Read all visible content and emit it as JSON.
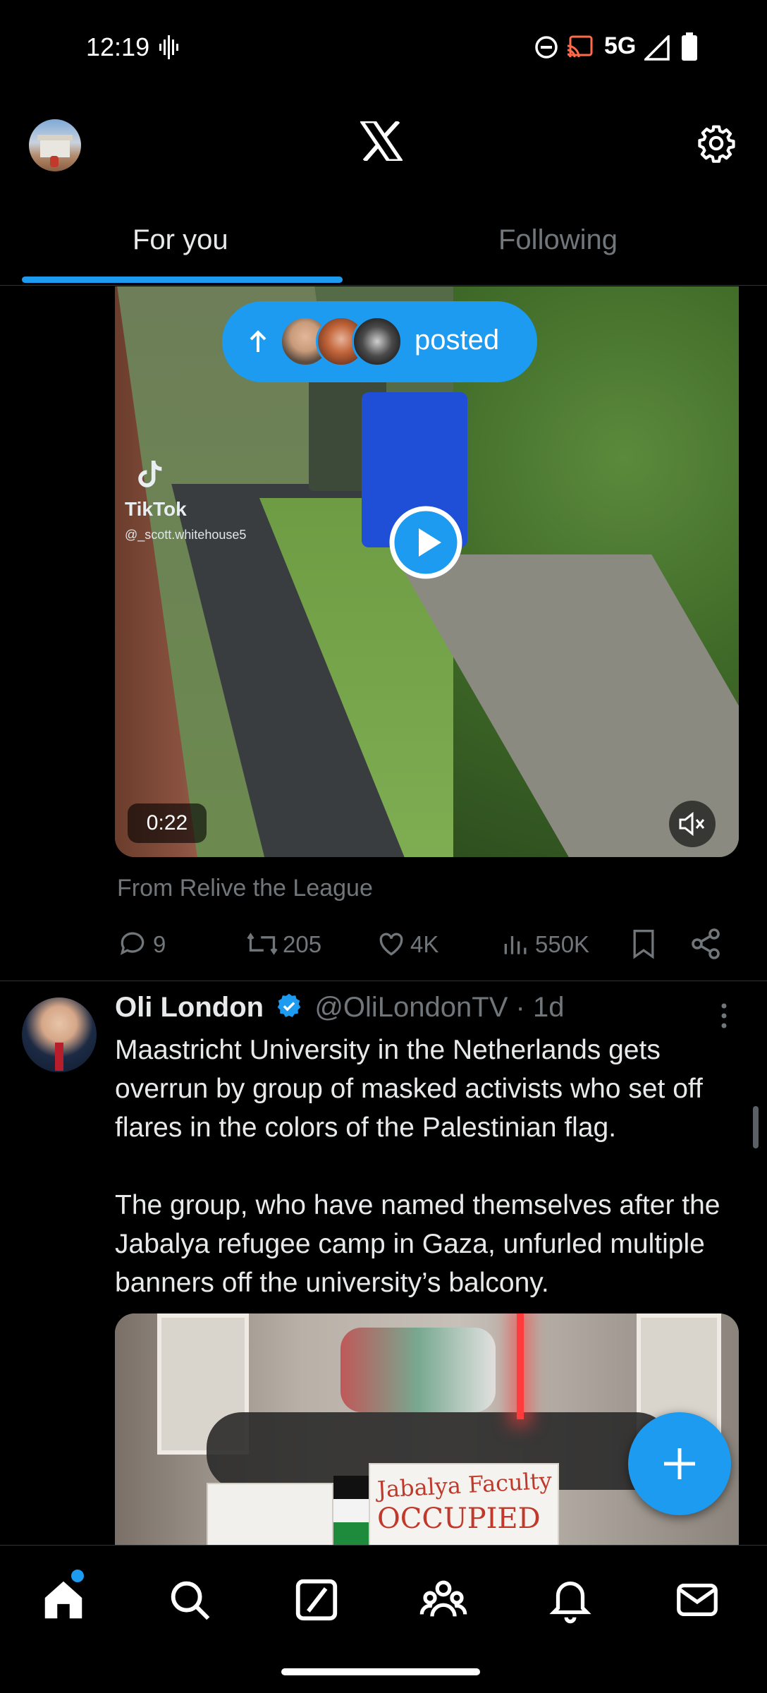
{
  "status_bar": {
    "time": "12:19",
    "network": "5G"
  },
  "header": {
    "logo": "X"
  },
  "tabs": [
    {
      "label": "For you",
      "active": true
    },
    {
      "label": "Following",
      "active": false
    }
  ],
  "posted_pill": {
    "label": "posted"
  },
  "tweet1": {
    "video": {
      "duration": "0:22",
      "watermark_brand": "TikTok",
      "watermark_handle": "@_scott.whitehouse5"
    },
    "source": "From Relive the League",
    "stats": {
      "replies": "9",
      "reposts": "205",
      "likes": "4K",
      "views": "550K"
    }
  },
  "tweet2": {
    "name": "Oli London",
    "handle": "@OliLondonTV",
    "time": "· 1d",
    "text": "Maastricht University in the Netherlands gets overrun by group of masked activists who set off flares in the colors of the Palestinian flag.\n\nThe group, who have named themselves after the Jabalya refugee camp in Gaza, unfurled multiple banners off the university’s balcony.",
    "image_text": {
      "banner": "Jabalya Faculty",
      "banner2": "OCCUPIED"
    }
  },
  "colors": {
    "accent": "#1d9bf0",
    "background": "#000000",
    "muted": "#71767b"
  }
}
